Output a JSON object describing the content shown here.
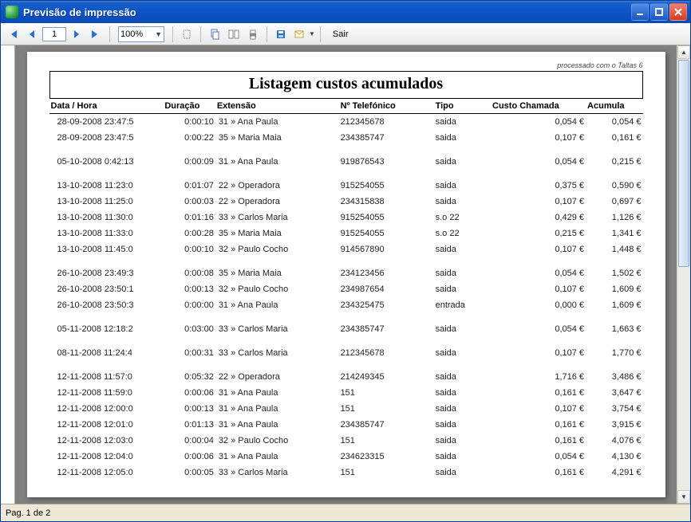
{
  "window": {
    "title": "Previsão de impressão"
  },
  "toolbar": {
    "page_value": "1",
    "zoom_value": "100%",
    "exit_label": "Sair"
  },
  "report": {
    "processed_note": "processado com o Taltas 6",
    "title": "Listagem custos acumulados",
    "headers": {
      "date": "Data / Hora",
      "duration": "Duração",
      "extension": "Extensão",
      "phone": "Nº Telefónico",
      "type": "Tipo",
      "cost": "Custo Chamada",
      "accum": "Acumula"
    },
    "rows": [
      {
        "date": "28-09-2008 23:47:5",
        "dur": "0:00:10",
        "ext": "31 » Ana Paula",
        "tel": "212345678",
        "type": "saida",
        "cost": "0,054 €",
        "acc": "0,054 €"
      },
      {
        "date": "28-09-2008 23:47:5",
        "dur": "0:00:22",
        "ext": "35 » Maria Maia",
        "tel": "234385747",
        "type": "saida",
        "cost": "0,107 €",
        "acc": "0,161 €",
        "gap": true
      },
      {
        "date": "05-10-2008 0:42:13",
        "dur": "0:00:09",
        "ext": "31 » Ana Paula",
        "tel": "919876543",
        "type": "saida",
        "cost": "0,054 €",
        "acc": "0,215 €",
        "gap": true
      },
      {
        "date": "13-10-2008 11:23:0",
        "dur": "0:01:07",
        "ext": "22 » Operadora",
        "tel": "915254055",
        "type": "saida",
        "cost": "0,375 €",
        "acc": "0,590 €"
      },
      {
        "date": "13-10-2008 11:25:0",
        "dur": "0:00:03",
        "ext": "22 » Operadora",
        "tel": "234315838",
        "type": "saida",
        "cost": "0,107 €",
        "acc": "0,697 €"
      },
      {
        "date": "13-10-2008 11:30:0",
        "dur": "0:01:16",
        "ext": "33 » Carlos Maria",
        "tel": "915254055",
        "type": "s.o 22",
        "cost": "0,429 €",
        "acc": "1,126 €"
      },
      {
        "date": "13-10-2008 11:33:0",
        "dur": "0:00:28",
        "ext": "35 » Maria Maia",
        "tel": "915254055",
        "type": "s.o 22",
        "cost": "0,215 €",
        "acc": "1,341 €"
      },
      {
        "date": "13-10-2008 11:45:0",
        "dur": "0:00:10",
        "ext": "32 » Paulo Cocho",
        "tel": "914567890",
        "type": "saida",
        "cost": "0,107 €",
        "acc": "1,448 €",
        "gap": true
      },
      {
        "date": "26-10-2008 23:49:3",
        "dur": "0:00:08",
        "ext": "35 » Maria Maia",
        "tel": "234123456",
        "type": "saida",
        "cost": "0,054 €",
        "acc": "1,502 €"
      },
      {
        "date": "26-10-2008 23:50:1",
        "dur": "0:00:13",
        "ext": "32 » Paulo Cocho",
        "tel": "234987654",
        "type": "saida",
        "cost": "0,107 €",
        "acc": "1,609 €"
      },
      {
        "date": "26-10-2008 23:50:3",
        "dur": "0:00:00",
        "ext": "31 » Ana Paula",
        "tel": "234325475",
        "type": "entrada",
        "cost": "0,000 €",
        "acc": "1,609 €",
        "gap": true
      },
      {
        "date": "05-11-2008 12:18:2",
        "dur": "0:03:00",
        "ext": "33 » Carlos Maria",
        "tel": "234385747",
        "type": "saida",
        "cost": "0,054 €",
        "acc": "1,663 €",
        "gap": true
      },
      {
        "date": "08-11-2008 11:24:4",
        "dur": "0:00:31",
        "ext": "33 » Carlos Maria",
        "tel": "212345678",
        "type": "saida",
        "cost": "0,107 €",
        "acc": "1,770 €",
        "gap": true
      },
      {
        "date": "12-11-2008 11:57:0",
        "dur": "0:05:32",
        "ext": "22 » Operadora",
        "tel": "214249345",
        "type": "saida",
        "cost": "1,716 €",
        "acc": "3,486 €"
      },
      {
        "date": "12-11-2008 11:59:0",
        "dur": "0:00:06",
        "ext": "31 » Ana Paula",
        "tel": "151",
        "type": "saida",
        "cost": "0,161 €",
        "acc": "3,647 €"
      },
      {
        "date": "12-11-2008 12:00:0",
        "dur": "0:00:13",
        "ext": "31 » Ana Paula",
        "tel": "151",
        "type": "saida",
        "cost": "0,107 €",
        "acc": "3,754 €"
      },
      {
        "date": "12-11-2008 12:01:0",
        "dur": "0:01:13",
        "ext": "31 » Ana Paula",
        "tel": "234385747",
        "type": "saida",
        "cost": "0,161 €",
        "acc": "3,915 €"
      },
      {
        "date": "12-11-2008 12:03:0",
        "dur": "0:00:04",
        "ext": "32 » Paulo Cocho",
        "tel": "151",
        "type": "saida",
        "cost": "0,161 €",
        "acc": "4,076 €"
      },
      {
        "date": "12-11-2008 12:04:0",
        "dur": "0:00:06",
        "ext": "31 » Ana Paula",
        "tel": "234623315",
        "type": "saida",
        "cost": "0,054 €",
        "acc": "4,130 €"
      },
      {
        "date": "12-11-2008 12:05:0",
        "dur": "0:00:05",
        "ext": "33 » Carlos Maria",
        "tel": "151",
        "type": "saida",
        "cost": "0,161 €",
        "acc": "4,291 €"
      }
    ]
  },
  "status": {
    "page_text": "Pag. 1  de  2"
  }
}
